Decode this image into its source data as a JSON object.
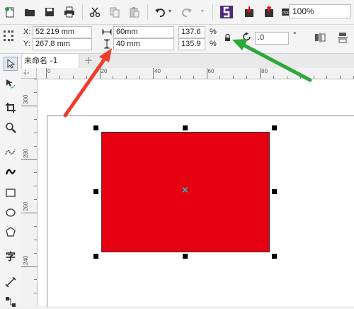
{
  "toolbar": {
    "icons": [
      "new-document-icon",
      "open-folder-icon",
      "save-icon",
      "print-icon",
      "cut-icon",
      "copy-icon",
      "paste-icon",
      "undo-icon",
      "redo-icon",
      "app-launcher-icon",
      "import-icon",
      "export-icon",
      "export-pdf-icon"
    ],
    "zoom_value": "100%"
  },
  "property_bar": {
    "x_label": "X:",
    "x_value": "52.219 mm",
    "y_label": "Y:",
    "y_value": "267.8 mm",
    "width_value": "60mm",
    "height_value": "40 mm",
    "scale_x_value": "137.6",
    "scale_y_value": "135.9",
    "percent_unit": "%",
    "rotation_value": ".0",
    "degree_unit": "°"
  },
  "document": {
    "tab_name": "未命名 -1",
    "add_tab_label": "+"
  },
  "left_tools": [
    "pick-tool-icon",
    "shape-tool-icon",
    "crop-tool-icon",
    "zoom-tool-icon",
    "freehand-tool-icon",
    "artistic-media-tool-icon",
    "rectangle-tool-icon",
    "ellipse-tool-icon",
    "polygon-tool-icon",
    "text-tool-icon",
    "dimension-tool-icon",
    "connector-tool-icon"
  ],
  "text_tool_glyph": "字",
  "rulers": {
    "horizontal_labels": [
      "0",
      "20",
      "40",
      "60",
      "80"
    ],
    "vertical_labels": [
      "300",
      "280",
      "260",
      "240"
    ]
  },
  "canvas": {
    "rectangle_fill": "#e60012",
    "center_marker": "×"
  },
  "colors": {
    "arrow_red": "#f03a2a",
    "arrow_green": "#2aa838"
  }
}
